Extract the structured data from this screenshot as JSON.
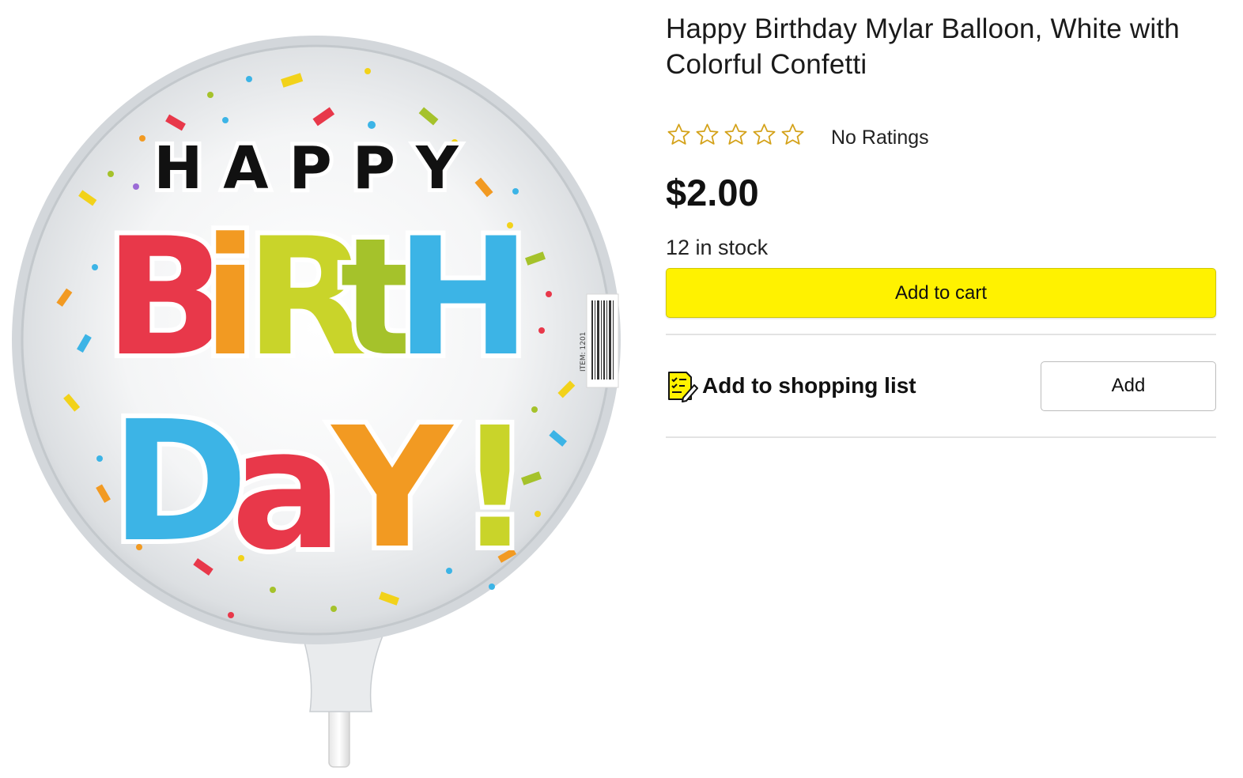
{
  "product": {
    "title": "Happy Birthday Mylar Balloon, White with Colorful Confetti",
    "rating": {
      "stars_filled": 0,
      "stars_total": 5,
      "label": "No Ratings"
    },
    "price": "$2.00",
    "stock": "12 in stock",
    "add_to_cart_label": "Add to cart",
    "shopping_list": {
      "label": "Add to shopping list",
      "button_label": "Add"
    }
  },
  "image": {
    "balloon_text": {
      "line1": "HAPPY",
      "line2": "BiRtH",
      "line3": "DaY!"
    },
    "item_label": "ITEM: 1201"
  },
  "colors": {
    "accent_yellow": "#fff200",
    "star_outline": "#d4a21a",
    "balloon_red": "#e8384a",
    "balloon_orange": "#f29a22",
    "balloon_lime": "#c9d42a",
    "balloon_blue": "#3cb4e6"
  }
}
